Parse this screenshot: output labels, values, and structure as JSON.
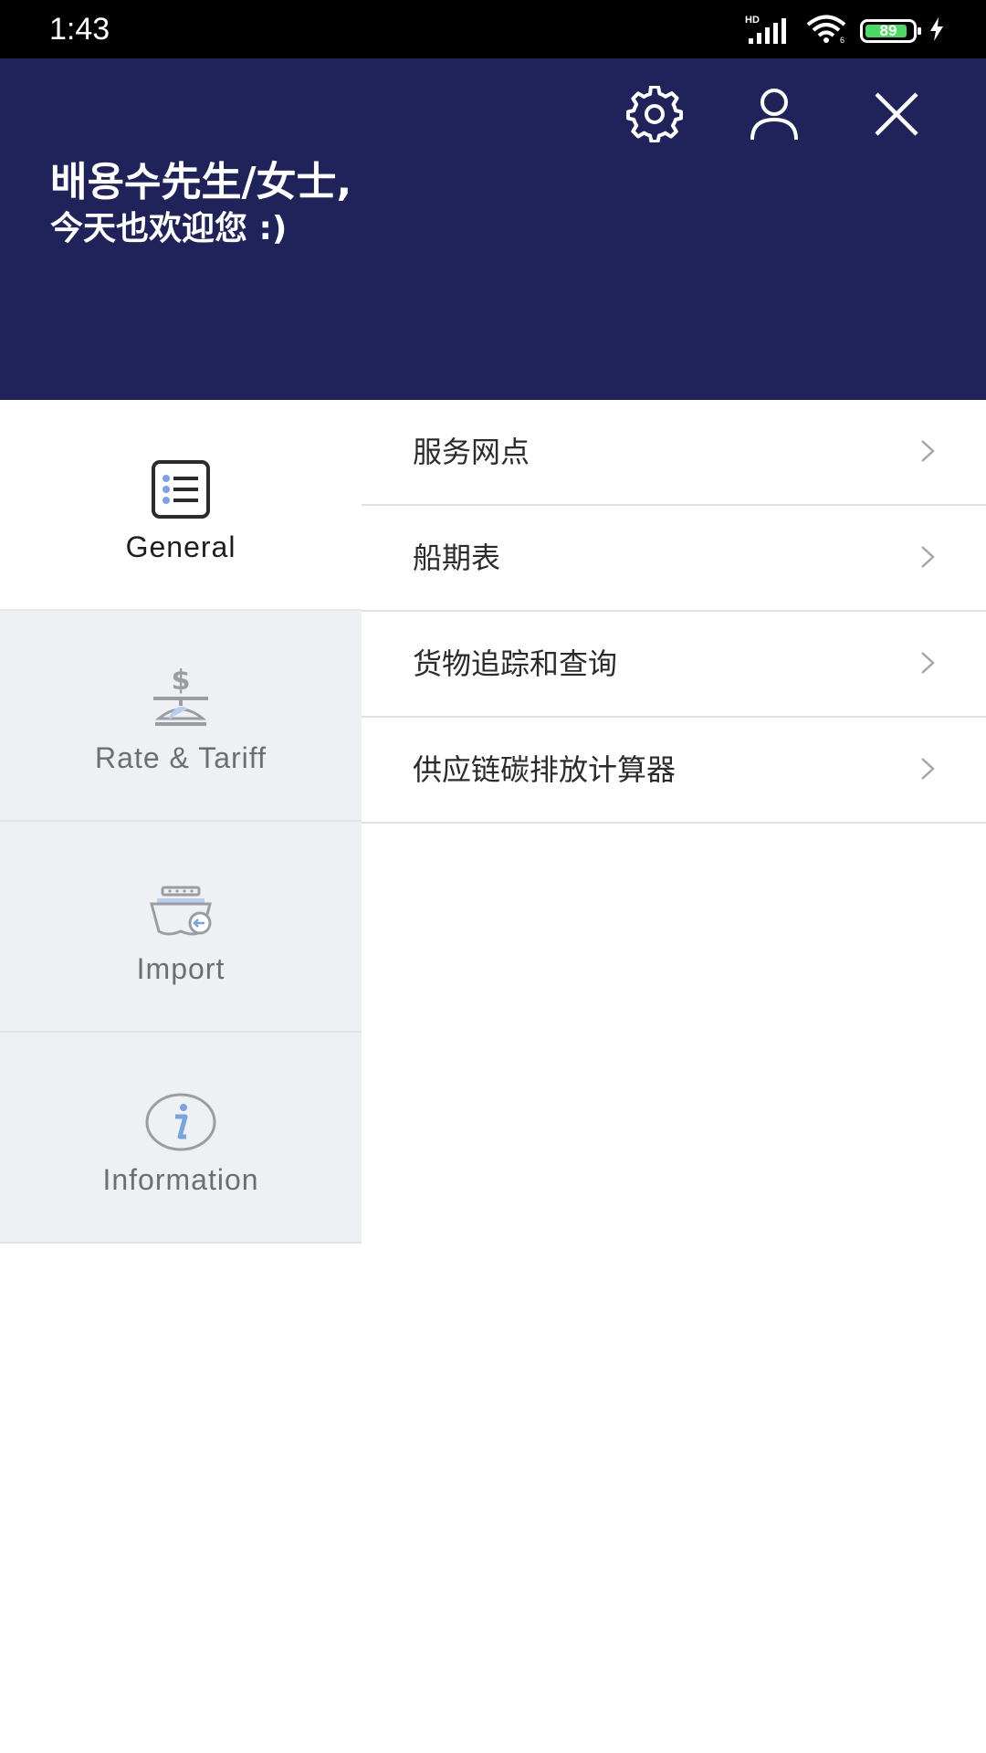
{
  "status_bar": {
    "time": "1:43",
    "network_label": "HD",
    "battery_level": "89",
    "battery_fraction": 0.89,
    "icons": [
      "signal-icon",
      "wifi-icon",
      "battery-icon",
      "charging-icon"
    ]
  },
  "header": {
    "background_color": "#20235a",
    "greeting_name": "배용수先生/女士,",
    "greeting_sub": "今天也欢迎您 :)",
    "icons": [
      "gear-icon",
      "user-icon",
      "close-icon"
    ]
  },
  "categories": [
    {
      "label": "General",
      "icon": "list-icon",
      "active": true
    },
    {
      "label": "Rate & Tariff",
      "icon": "scale-dollar-icon",
      "active": false
    },
    {
      "label": "Import",
      "icon": "ship-import-icon",
      "active": false
    },
    {
      "label": "Information",
      "icon": "info-icon",
      "active": false
    }
  ],
  "menu_items": [
    {
      "label": "服务网点"
    },
    {
      "label": "船期表"
    },
    {
      "label": "货物追踪和查询"
    },
    {
      "label": "供应链碳排放计算器"
    }
  ],
  "colors": {
    "accent_blue": "#20235a",
    "inactive_tab_bg": "#eff0f4",
    "icon_light_blue": "#b8cef0"
  }
}
